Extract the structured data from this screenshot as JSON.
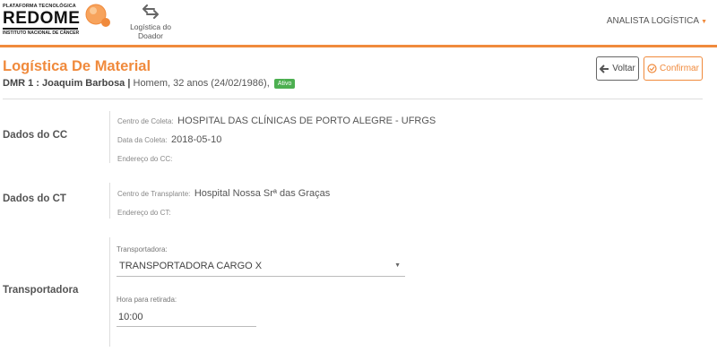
{
  "brand": {
    "top_line": "PLATAFORMA TECNOLÓGICA",
    "name": "REDOME",
    "sub_line": "INSTITUTO NACIONAL DE CÂNCER",
    "accent": "#f08a3c"
  },
  "nav": {
    "items": [
      {
        "label": "Logística do Doador",
        "icon": "swap-arrows-icon"
      }
    ]
  },
  "user_menu": {
    "label": "ANALISTA LOGÍSTICA",
    "caret": "▼"
  },
  "page": {
    "title": "Logística De Material",
    "patient_prefix": "DMR 1 : Joaquim Barbosa |",
    "patient_details": " Homem, 32 anos (24/02/1986),",
    "status_badge": "Ativo"
  },
  "actions": {
    "back_label": "Voltar",
    "confirm_label": "Confirmar"
  },
  "sections": {
    "cc": {
      "title": "Dados do CC",
      "centro_label": "Centro de Coleta:",
      "centro_value": "HOSPITAL DAS CLÍNICAS DE PORTO ALEGRE - UFRGS",
      "data_label": "Data da Coleta:",
      "data_value": "2018-05-10",
      "endereco_label": "Endereço do CC:",
      "endereco_value": ""
    },
    "ct": {
      "title": "Dados do CT",
      "centro_label": "Centro de Transplante:",
      "centro_value": "Hospital Nossa Srª das Graças",
      "endereco_label": "Endereço do CT:",
      "endereco_value": ""
    },
    "transport": {
      "title": "Transportadora",
      "carrier_label": "Transportadora:",
      "carrier_value": "TRANSPORTADORA CARGO X",
      "time_label": "Hora para retirada:",
      "time_value": "10:00"
    }
  },
  "colors": {
    "accent": "#f08a3c",
    "badge_green": "#4caf50"
  }
}
